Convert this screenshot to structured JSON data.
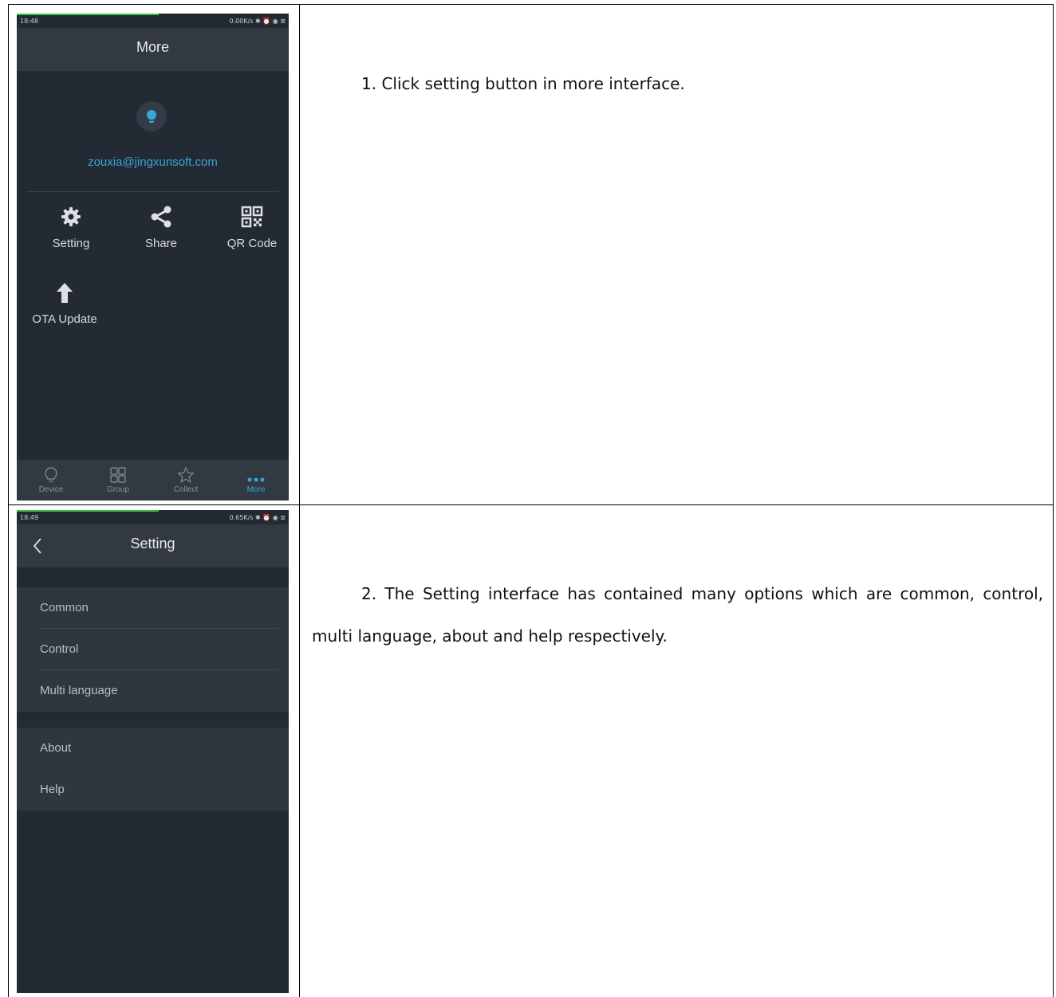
{
  "steps": [
    {
      "text": "1. Click setting button in more interface.",
      "screen": {
        "time": "18:48",
        "status_right": "0.00K/s ✱ ⏰ ◉ ≣",
        "title": "More",
        "avatar_icon": "bulb-icon",
        "email": "zouxia@jingxunsoft.com",
        "tiles": [
          {
            "label": "Setting",
            "icon": "gear-icon"
          },
          {
            "label": "Share",
            "icon": "share-icon"
          },
          {
            "label": "QR Code",
            "icon": "qr-code-icon"
          },
          {
            "label": "OTA Update",
            "icon": "arrow-up-icon"
          }
        ],
        "nav": [
          {
            "label": "Device",
            "icon": "bulb-outline-icon",
            "active": false
          },
          {
            "label": "Group",
            "icon": "grid-icon",
            "active": false
          },
          {
            "label": "Collect",
            "icon": "star-icon",
            "active": false
          },
          {
            "label": "More",
            "icon": "more-dots-icon",
            "active": true
          }
        ]
      }
    },
    {
      "text": "2. The Setting interface has contained many options which are common, control, multi language, about and help respectively.",
      "screen": {
        "time": "18:49",
        "status_right": "0.65K/s ✱ ⏰ ◉ ≣",
        "title": "Setting",
        "group1": [
          "Common",
          "Control",
          "Multi language"
        ],
        "group2": [
          "About",
          "Help"
        ]
      }
    }
  ],
  "colors": {
    "screen_bg": "#242a33",
    "bar_bg": "#323943",
    "accent": "#34a7d6"
  }
}
